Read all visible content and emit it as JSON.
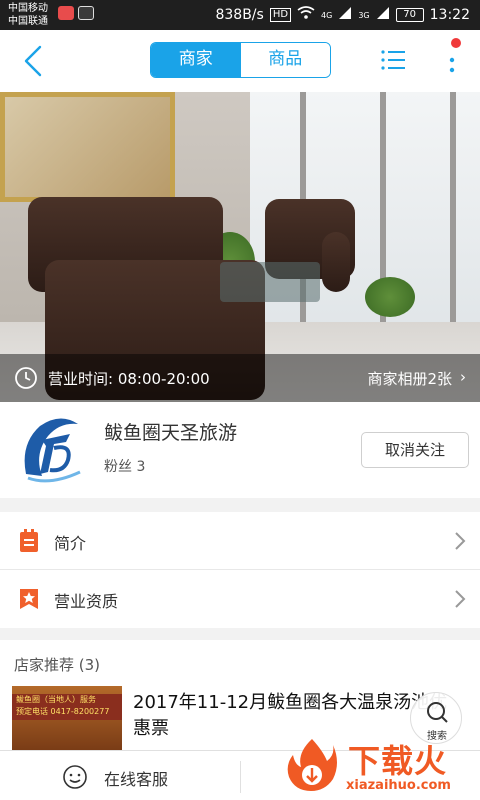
{
  "status_bar": {
    "carrier_1": "中国移动",
    "carrier_2": "中国联通",
    "speed": "838B/s",
    "hd": "HD",
    "signal_1": "4G",
    "signal_2": "3G",
    "battery": "70",
    "time": "13:22"
  },
  "nav": {
    "tabs": [
      "商家",
      "商品"
    ],
    "active_tab": "商家",
    "accent_color": "#1aa3e8",
    "badge_color": "#f0393a"
  },
  "hero": {
    "hours_label": "营业时间: 08:00-20:00",
    "album_label": "商家相册2张"
  },
  "merchant": {
    "name": "鲅鱼圈天圣旅游",
    "fans": "粉丝  3",
    "unfollow_label": "取消关注"
  },
  "menu": [
    {
      "label": "简介",
      "icon": "document-icon"
    },
    {
      "label": "营业资质",
      "icon": "star-badge-icon"
    }
  ],
  "recommend": {
    "title": "店家推荐 (3)",
    "item_title": "2017年11-12月鲅鱼圈各大温泉汤池优惠票",
    "thumb_text_1": "鲅鱼圈（当地人）服务",
    "thumb_text_2": "预定电话 0417-8200277",
    "search_label": "搜索"
  },
  "bottom_bar": {
    "customer_service": "在线客服"
  },
  "watermark": {
    "brand": "下载火",
    "url": "xiazaihuo.com"
  }
}
